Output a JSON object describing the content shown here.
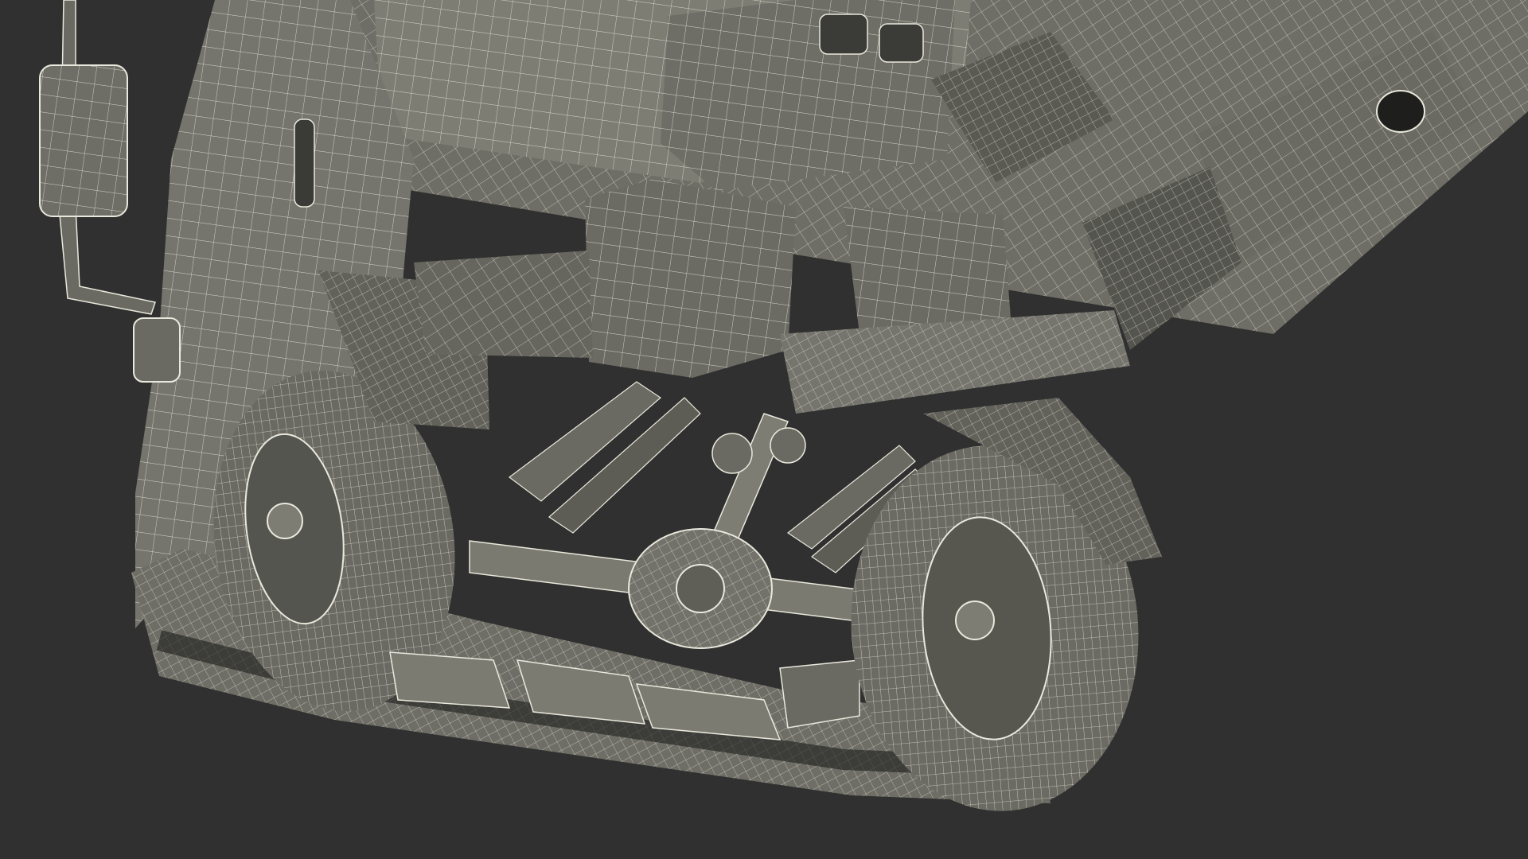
{
  "scene": {
    "subject": "truck-underside-wireframe",
    "colors": {
      "background": "#303030",
      "surface_light": "#7d7d74",
      "surface_mid": "#5f5f58",
      "surface_dark": "#45453f",
      "wire": "#e9e8dc",
      "shadow": "#262624"
    }
  }
}
